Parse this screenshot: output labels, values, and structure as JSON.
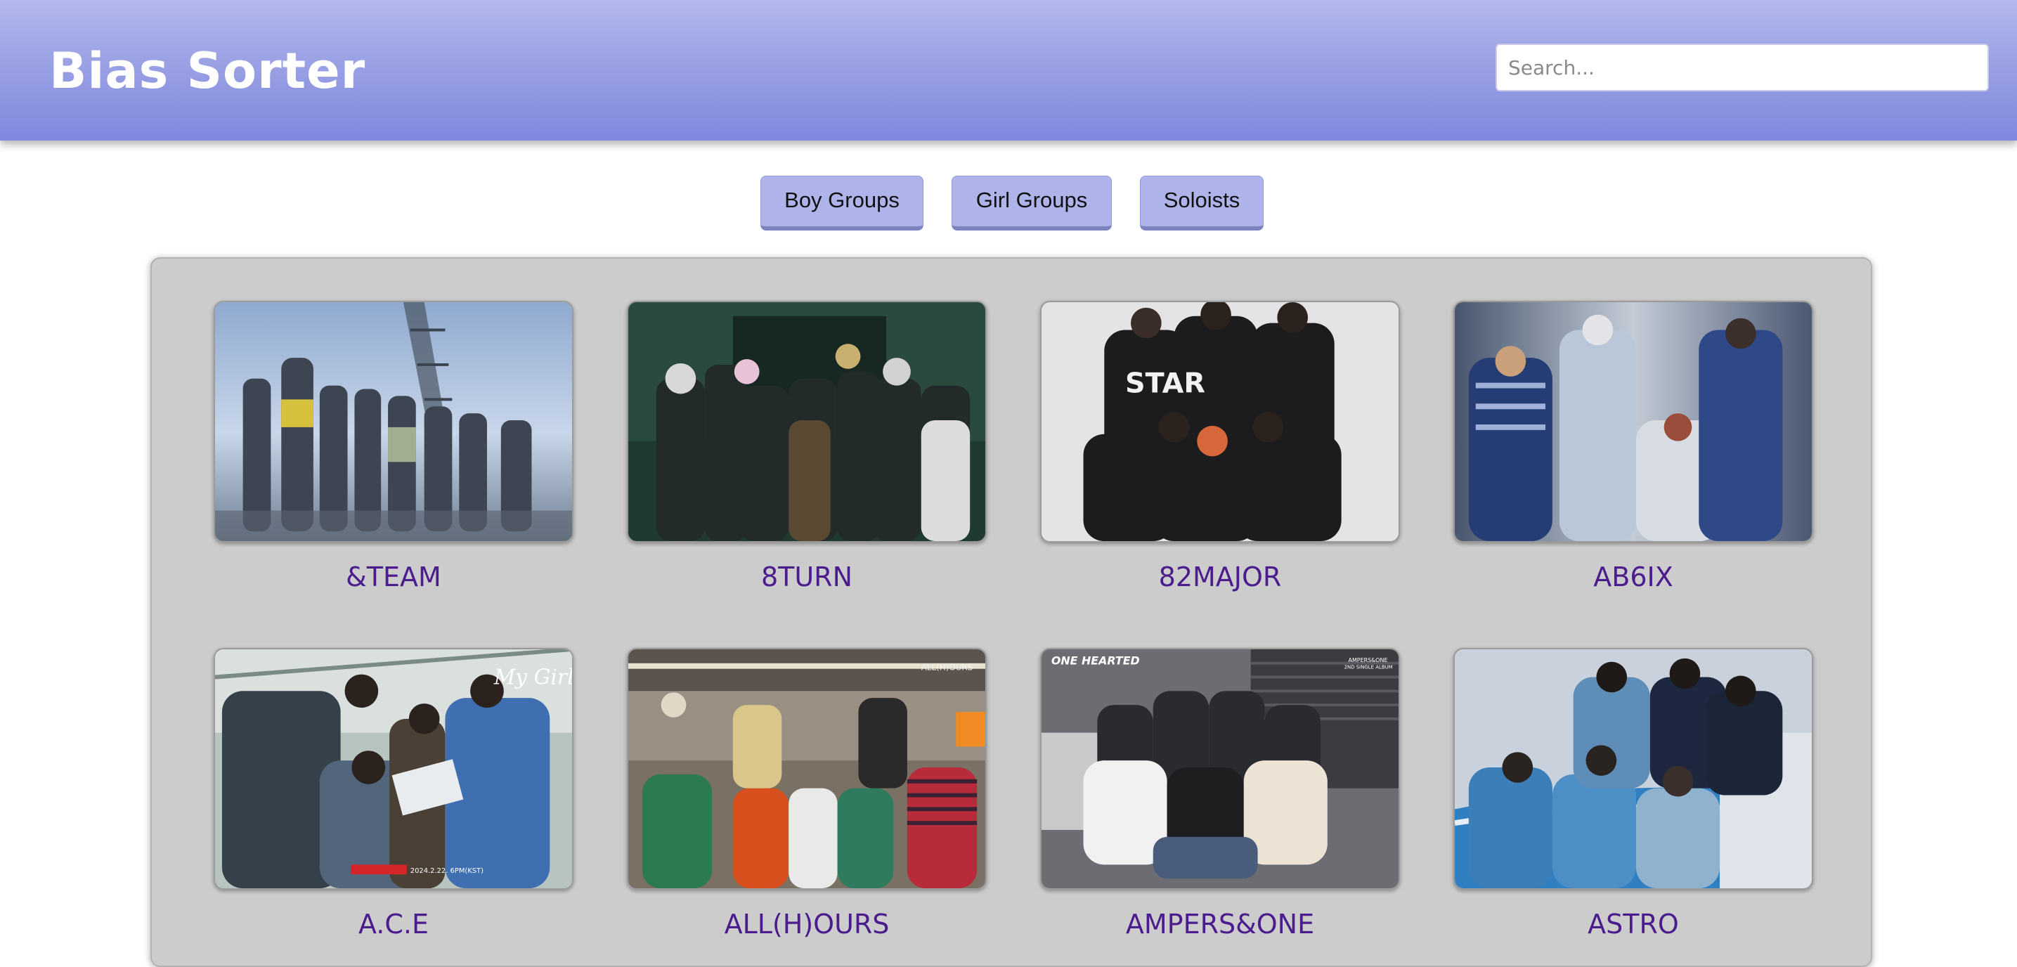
{
  "header": {
    "title": "Bias Sorter",
    "search_placeholder": "Search..."
  },
  "categories": {
    "boy_groups": "Boy Groups",
    "girl_groups": "Girl Groups",
    "soloists": "Soloists"
  },
  "groups": [
    {
      "name": "&TEAM",
      "image": "group-photo"
    },
    {
      "name": "8TURN",
      "image": "group-photo"
    },
    {
      "name": "82MAJOR",
      "image": "group-photo"
    },
    {
      "name": "AB6IX",
      "image": "group-photo"
    },
    {
      "name": "A.C.E",
      "image": "group-photo",
      "photo_text": [
        "My Girl",
        "2024.2.22. 6PM(KST)"
      ]
    },
    {
      "name": "ALL(H)OURS",
      "image": "group-photo",
      "photo_text": [
        "ALL(H)OURS"
      ]
    },
    {
      "name": "AMPERS&ONE",
      "image": "group-photo",
      "photo_text": [
        "ONE HEARTED",
        "AMPERS&ONE",
        "2ND SINGLE ALBUM"
      ]
    },
    {
      "name": "ASTRO",
      "image": "group-photo"
    }
  ],
  "colors": {
    "header_top": "#b4b9ec",
    "header_bottom": "#7f87de",
    "button_bg": "#aeb3ea",
    "panel_bg": "#cccccc",
    "label_color": "#4b1c8d"
  }
}
